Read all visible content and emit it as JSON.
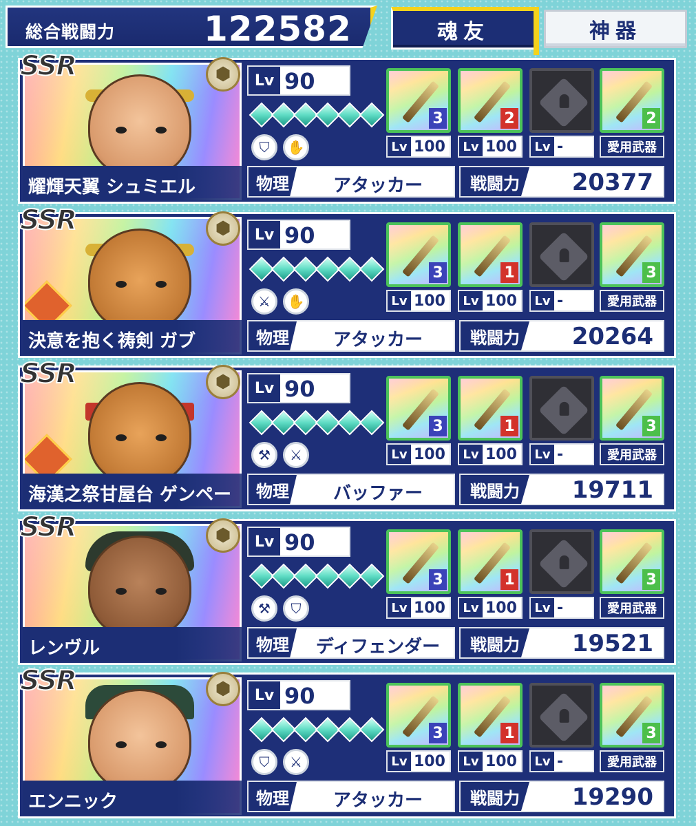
{
  "header": {
    "total_label": "総合戦闘力",
    "total_value": "122582",
    "tabs": [
      "魂友",
      "神器"
    ],
    "accent_color": "#f4d21c",
    "navy": "#1c2e75"
  },
  "labels": {
    "rarity": "SSR",
    "lv": "Lv",
    "attribute_tag": "物理",
    "power_tag": "戦闘力",
    "favorite_weapon": "愛用武器"
  },
  "characters": [
    {
      "name": "耀輝天翼 シュミエル",
      "level": "90",
      "role": "アタッカー",
      "power": "20377",
      "skill_icons": [
        "shield-icon",
        "gauntlet-icon"
      ],
      "equipment": [
        {
          "icon": "shield-item-icon",
          "rank": "3",
          "level": "100"
        },
        {
          "icon": "bracer-item-icon",
          "rank": "2",
          "level": "100"
        },
        {
          "icon": "locked-slot-icon",
          "rank": "",
          "level": "-"
        },
        {
          "icon": "spear-item-icon",
          "rank": "2",
          "level": "愛用武器"
        }
      ]
    },
    {
      "name": "決意を抱く祷剣 ガブ",
      "level": "90",
      "role": "アタッカー",
      "power": "20264",
      "skill_icons": [
        "sword-icon",
        "gauntlet-icon"
      ],
      "equipment": [
        {
          "icon": "scythe-item-icon",
          "rank": "3",
          "level": "100"
        },
        {
          "icon": "green-blade-item-icon",
          "rank": "1",
          "level": "100"
        },
        {
          "icon": "locked-slot-icon",
          "rank": "",
          "level": "-"
        },
        {
          "icon": "golden-sword-item-icon",
          "rank": "3",
          "level": "愛用武器"
        }
      ]
    },
    {
      "name": "海漢之祭甘屋台 ゲンペー",
      "level": "90",
      "role": "バッファー",
      "power": "19711",
      "skill_icons": [
        "axe-icon",
        "sword-icon"
      ],
      "equipment": [
        {
          "icon": "hammer-item-icon",
          "rank": "3",
          "level": "100"
        },
        {
          "icon": "mallet-item-icon",
          "rank": "1",
          "level": "100"
        },
        {
          "icon": "locked-slot-icon",
          "rank": "",
          "level": "-"
        },
        {
          "icon": "crossed-tools-item-icon",
          "rank": "3",
          "level": "愛用武器"
        }
      ]
    },
    {
      "name": "レンヴル",
      "level": "90",
      "role": "ディフェンダー",
      "power": "19521",
      "skill_icons": [
        "axe-icon",
        "shield-icon"
      ],
      "equipment": [
        {
          "icon": "katana-item-icon",
          "rank": "3",
          "level": "100"
        },
        {
          "icon": "ice-crystal-item-icon",
          "rank": "1",
          "level": "100"
        },
        {
          "icon": "locked-slot-icon",
          "rank": "",
          "level": "-"
        },
        {
          "icon": "battle-axe-item-icon",
          "rank": "3",
          "level": "愛用武器"
        }
      ]
    },
    {
      "name": "エンニック",
      "level": "90",
      "role": "アタッカー",
      "power": "19290",
      "skill_icons": [
        "shield-icon",
        "sword-icon"
      ],
      "equipment": [
        {
          "icon": "rapier-item-icon",
          "rank": "3",
          "level": "100"
        },
        {
          "icon": "golden-bow-item-icon",
          "rank": "1",
          "level": "100"
        },
        {
          "icon": "locked-slot-icon",
          "rank": "",
          "level": "-"
        },
        {
          "icon": "curved-sword-item-icon",
          "rank": "3",
          "level": "愛用武器"
        }
      ]
    }
  ]
}
